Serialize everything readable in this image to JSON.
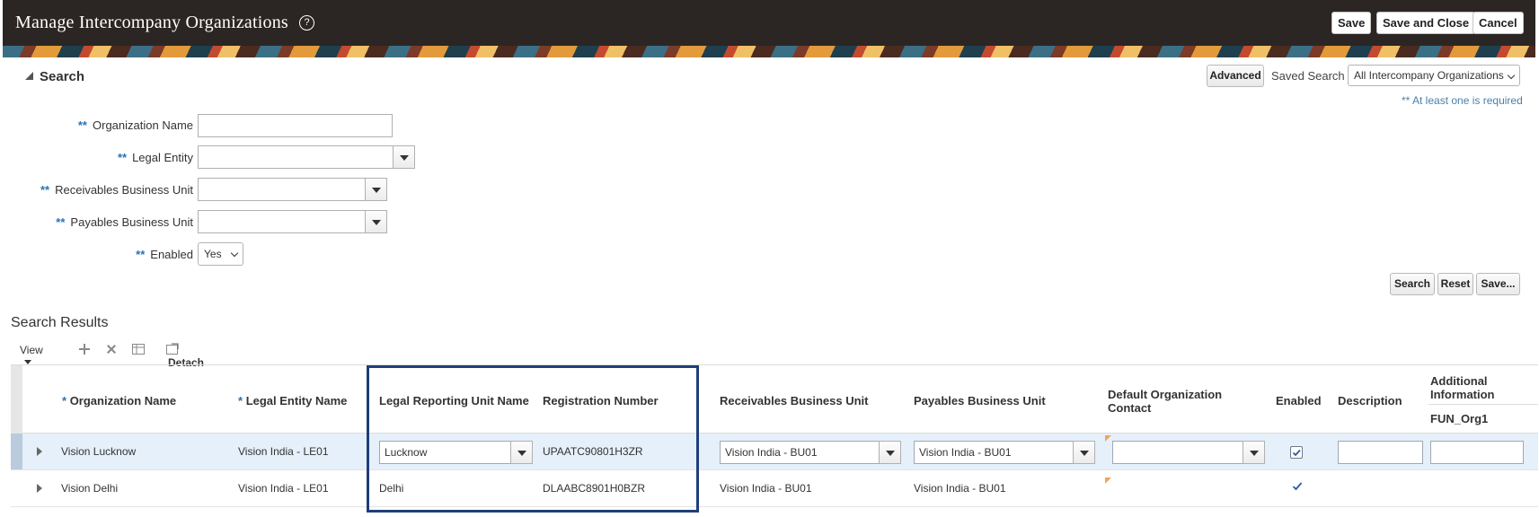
{
  "header": {
    "title": "Manage Intercompany Organizations",
    "help": "?",
    "save_label": "Save",
    "save_close_label": "Save and Close",
    "cancel_label": "Cancel"
  },
  "search": {
    "heading": "Search",
    "advanced_label": "Advanced",
    "saved_search_label": "Saved Search",
    "saved_search_value": "All Intercompany Organizations",
    "required_note": "** At least one is required",
    "fields": {
      "org_name": {
        "star": "**",
        "label": "Organization Name",
        "value": ""
      },
      "legal_entity": {
        "star": "**",
        "label": "Legal Entity",
        "value": ""
      },
      "receivables_bu": {
        "star": "**",
        "label": "Receivables Business Unit",
        "value": ""
      },
      "payables_bu": {
        "star": "**",
        "label": "Payables Business Unit",
        "value": ""
      },
      "enabled": {
        "star": "**",
        "label": "Enabled",
        "value": "Yes"
      }
    },
    "search_button": "Search",
    "reset_button": "Reset",
    "save_button": "Save..."
  },
  "results": {
    "title": "Search Results",
    "toolbar": {
      "view_label": "View",
      "detach_label": "Detach",
      "icons": [
        "add-icon",
        "delete-icon",
        "freeze-icon",
        "detach-icon"
      ]
    },
    "columns": {
      "org_name": {
        "star": "*",
        "label": "Organization Name"
      },
      "legal_entity_name": {
        "star": "*",
        "label": "Legal Entity Name"
      },
      "legal_reporting_unit": "Legal Reporting Unit Name",
      "registration_number": "Registration Number",
      "receivables_bu": "Receivables Business Unit",
      "payables_bu": "Payables Business Unit",
      "default_contact": "Default Organization Contact",
      "enabled": "Enabled",
      "description": "Description",
      "additional_info": "Additional Information",
      "fun_org1": "FUN_Org1"
    },
    "rows": [
      {
        "org_name": "Vision Lucknow",
        "legal_entity_name": "Vision India - LE01",
        "legal_reporting_unit": "Lucknow",
        "registration_number": "UPAATC90801H3ZR",
        "receivables_bu": "Vision India - BU01",
        "payables_bu": "Vision India - BU01",
        "default_contact": "",
        "enabled": true,
        "description": "",
        "fun_org1": ""
      },
      {
        "org_name": "Vision Delhi",
        "legal_entity_name": "Vision India - LE01",
        "legal_reporting_unit": "Delhi",
        "registration_number": "DLAABC8901H0BZR",
        "receivables_bu": "Vision India - BU01",
        "payables_bu": "Vision India - BU01",
        "default_contact": "",
        "enabled": true,
        "description": "",
        "fun_org1": ""
      }
    ]
  },
  "colors": {
    "header_bg": "#2b2623",
    "required_star": "#2a72b5",
    "selected_row": "#e5f0fa",
    "highlight_box": "#1f3e7a"
  }
}
